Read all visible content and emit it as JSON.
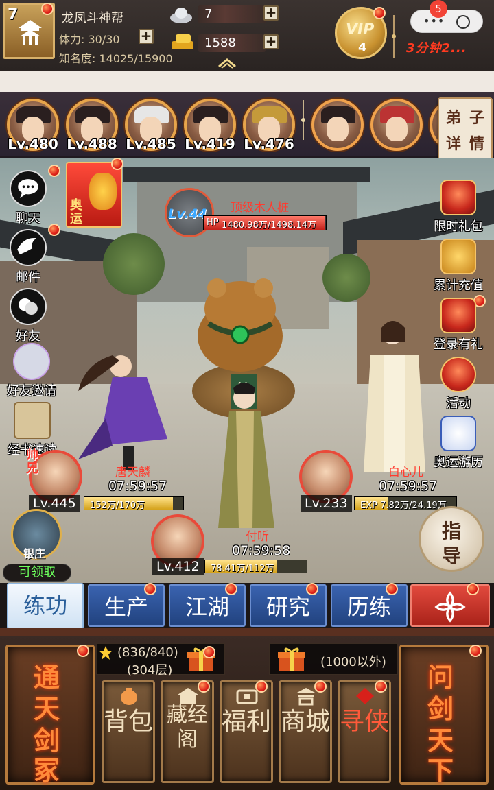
{
  "player": {
    "level": "7",
    "name": "龙凤斗神帮",
    "stamina": "体力: 30/30",
    "fame": "知名度: 14025/15900"
  },
  "currency": {
    "silver": "7",
    "gold": "1588",
    "plus": "+"
  },
  "vip": {
    "label": "VIP",
    "level": "4"
  },
  "event_logo": "3分钟2...",
  "capsule": {
    "dots": "•••",
    "badge": "5"
  },
  "disciples": [
    {
      "level": "Lv.480"
    },
    {
      "level": "Lv.488"
    },
    {
      "level": "Lv.485"
    },
    {
      "level": "Lv.419"
    },
    {
      "level": "Lv.476"
    },
    {
      "level": ""
    },
    {
      "level": ""
    }
  ],
  "disciple_detail": {
    "c1": "弟",
    "c2": "子",
    "c3": "详",
    "c4": "情"
  },
  "left_menu": [
    {
      "label": "聊天",
      "icon": "chat-icon"
    },
    {
      "label": "邮件",
      "icon": "mail-icon"
    },
    {
      "label": "好友",
      "icon": "friends-icon"
    },
    {
      "label": "好友邀请",
      "icon": "invite-icon"
    },
    {
      "label": "经书速读",
      "icon": "book-icon"
    }
  ],
  "olympic_badge": "奥运",
  "shuai_badge": "帅兄",
  "right_menu": [
    {
      "label": "限时礼包",
      "icon": "gift-pack-icon"
    },
    {
      "label": "累计充值",
      "icon": "recharge-icon"
    },
    {
      "label": "登录有礼",
      "icon": "login-gift-icon"
    },
    {
      "label": "活动",
      "icon": "activity-icon"
    },
    {
      "label": "奥运游历",
      "icon": "olympic-travel-icon"
    }
  ],
  "boss": {
    "level": "Lv.44",
    "name": "顶级木人桩",
    "hp_label": "HP",
    "hp_text": "1480.98万/1498.14万",
    "hp_fraction": 0.988
  },
  "toad_plate": "仙",
  "units": [
    {
      "name": "唐天麟",
      "timer": "07:59:57",
      "level": "Lv.445",
      "exp": "152万/170万",
      "exp_fraction": 0.894
    },
    {
      "name": "付听",
      "timer": "07:59:58",
      "level": "Lv.412",
      "exp": "78.41万/112万",
      "exp_fraction": 0.7
    },
    {
      "name": "白心儿",
      "timer": "07:59:57",
      "level": "Lv.233",
      "exp": "EXP 7.82万/24.19万",
      "exp_fraction": 0.323
    }
  ],
  "guide": {
    "c1": "指",
    "c2": "导"
  },
  "bank": {
    "label": "银庄",
    "claim": "可领取"
  },
  "tabs": [
    {
      "label": "练功",
      "active": true
    },
    {
      "label": "生产"
    },
    {
      "label": "江湖"
    },
    {
      "label": "研究"
    },
    {
      "label": "历练"
    },
    {
      "label": ""
    }
  ],
  "bottom": {
    "left_big": [
      "通",
      "天",
      "剑",
      "冢"
    ],
    "right_big": [
      "问",
      "剑",
      "天",
      "下"
    ],
    "progress": "(836/840)",
    "floor": "(304层)",
    "rank": "(1000以外)",
    "buttons": [
      {
        "label": "背包",
        "icon": "bag-icon"
      },
      {
        "label": "藏经阁",
        "icon": "library-icon"
      },
      {
        "label": "福利",
        "icon": "welfare-icon"
      },
      {
        "label": "商城",
        "icon": "shop-icon"
      },
      {
        "label": "寻侠",
        "icon": "seek-hero-icon"
      }
    ]
  },
  "colors": {
    "accent_red": "#e0231a",
    "tab_blue": "#21427e",
    "gold": "#e9c36f"
  }
}
